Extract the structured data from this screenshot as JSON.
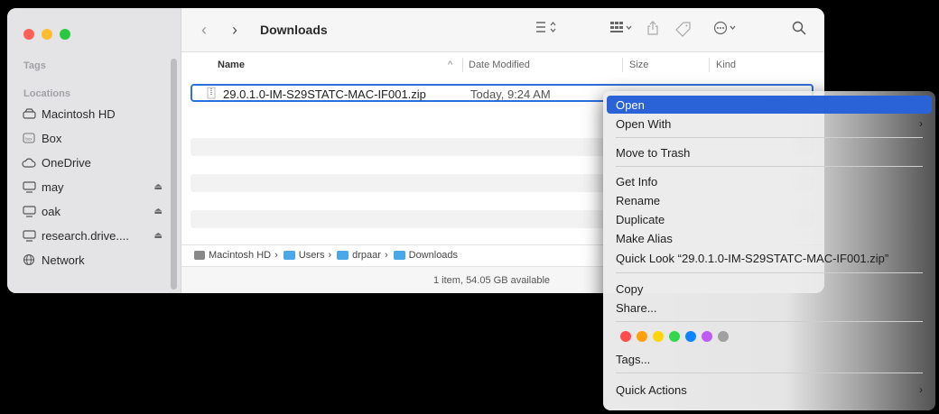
{
  "window": {
    "title": "Downloads",
    "traffic_colors": [
      "#ff5f57",
      "#febc2e",
      "#28c840"
    ]
  },
  "sidebar": {
    "tags_header": "Tags",
    "locations_header": "Locations",
    "items": [
      {
        "label": "Macintosh HD",
        "icon": "hard-drive-icon"
      },
      {
        "label": "Box",
        "icon": "box-icon"
      },
      {
        "label": "OneDrive",
        "icon": "cloud-icon"
      },
      {
        "label": "may",
        "icon": "display-icon",
        "eject": "⏏"
      },
      {
        "label": "oak",
        "icon": "display-icon",
        "eject": "⏏"
      },
      {
        "label": "research.drive....",
        "icon": "display-icon",
        "eject": "⏏"
      },
      {
        "label": "Network",
        "icon": "network-icon"
      }
    ]
  },
  "columns": {
    "name": "Name",
    "date": "Date Modified",
    "size": "Size",
    "kind": "Kind"
  },
  "file": {
    "name": "29.0.1.0-IM-S29STATC-MAC-IF001.zip",
    "date": "Today, 9:24 AM"
  },
  "pathbar": {
    "parts": [
      "Macintosh HD",
      "Users",
      "drpaar",
      "Downloads"
    ],
    "separator": "›"
  },
  "status": "1 item, 54.05 GB available",
  "context_menu": {
    "open": "Open",
    "open_with": "Open With",
    "move_to_trash": "Move to Trash",
    "get_info": "Get Info",
    "rename": "Rename",
    "duplicate": "Duplicate",
    "make_alias": "Make Alias",
    "quick_look": "Quick Look “29.0.1.0-IM-S29STATC-MAC-IF001.zip”",
    "copy": "Copy",
    "share": "Share...",
    "tags": "Tags...",
    "quick_actions": "Quick Actions",
    "submenu_arrow": "›",
    "tag_colors": [
      "#ff4d4d",
      "#ff9f0a",
      "#ffd60a",
      "#32d74b",
      "#0a84ff",
      "#bf5af2",
      "#a0a0a0"
    ]
  }
}
